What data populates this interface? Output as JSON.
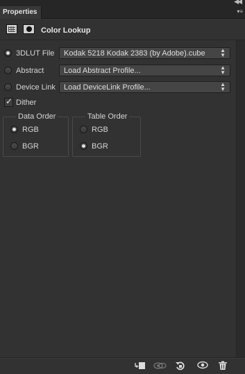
{
  "panel": {
    "tab_label": "Properties",
    "title": "Color Lookup"
  },
  "sources": [
    {
      "label": "3DLUT File",
      "value": "Kodak 5218 Kodak 2383 (by Adobe).cube",
      "selected": true
    },
    {
      "label": "Abstract",
      "value": "Load Abstract Profile...",
      "selected": false
    },
    {
      "label": "Device Link",
      "value": "Load DeviceLink Profile...",
      "selected": false
    }
  ],
  "dither": {
    "label": "Dither",
    "checked": true
  },
  "data_order": {
    "legend": "Data Order",
    "options": [
      "RGB",
      "BGR"
    ],
    "selected": "RGB"
  },
  "table_order": {
    "legend": "Table Order",
    "options": [
      "RGB",
      "BGR"
    ],
    "selected": "BGR"
  },
  "bottom_toolbar": [
    "clip-to-layer-icon",
    "view-previous-state-icon",
    "reset-icon",
    "visibility-icon",
    "delete-icon"
  ],
  "colors": {
    "panel_bg": "#323232",
    "tab_bg": "#383838",
    "field_bg": "#454545"
  }
}
